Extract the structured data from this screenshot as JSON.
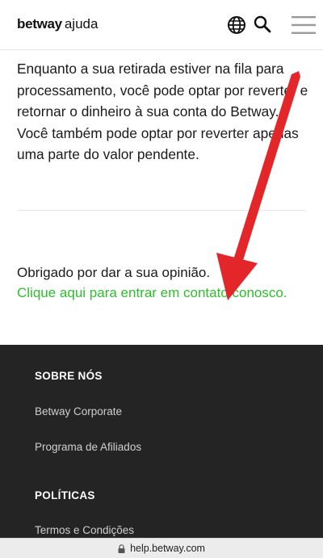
{
  "header": {
    "brand_logo": "betway",
    "brand_sub": "ajuda",
    "icons": [
      "globe-icon",
      "search-icon",
      "hamburger-menu-icon"
    ]
  },
  "article": {
    "body": "Enquanto a sua retirada estiver na fila para processamento, você pode optar por reverter e retornar o dinheiro à sua conta do Betway. Você também pode optar por reverter apenas uma parte do valor pendente."
  },
  "feedback": {
    "thanks": "Obrigado por dar a sua opinião.",
    "contact_link": "Clique aqui para entrar em contato conosco."
  },
  "footer": {
    "sections": [
      {
        "heading": "SOBRE NÓS",
        "links": [
          "Betway Corporate",
          "Programa de Afiliados"
        ]
      },
      {
        "heading": "POLÍTICAS",
        "links": [
          "Termos e Condições"
        ]
      }
    ]
  },
  "browser": {
    "url": "help.betway.com"
  },
  "colors": {
    "link_green": "#2dbd2d",
    "footer_bg": "#242424",
    "annotation_red": "#e3262a"
  }
}
